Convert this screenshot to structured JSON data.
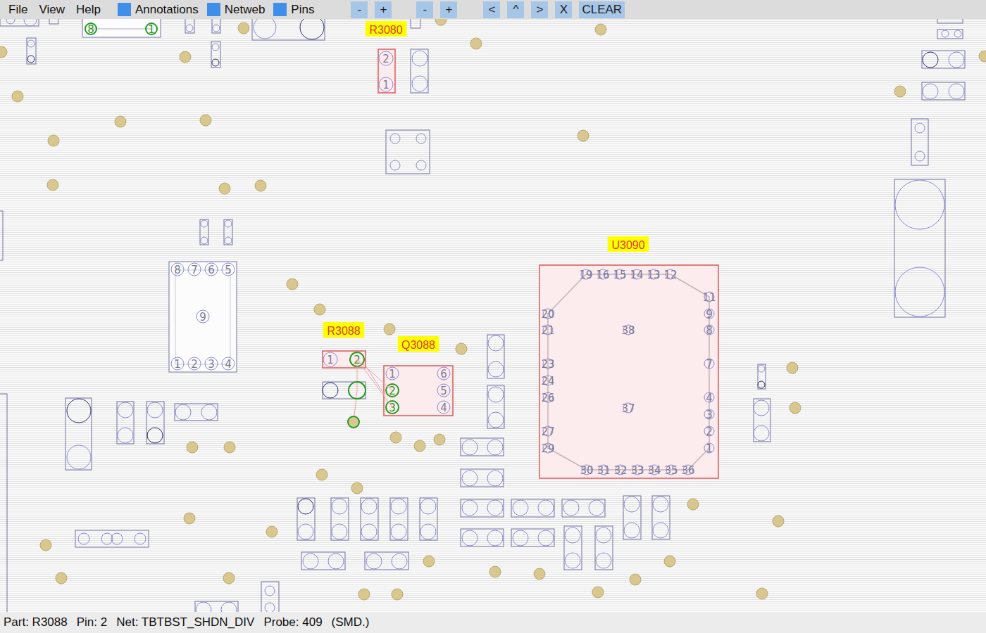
{
  "window": {
    "title": "OpenBoardView"
  },
  "menu": [
    "File",
    "View",
    "Help"
  ],
  "toggles": [
    {
      "label": "Annotations",
      "checked": true
    },
    {
      "label": "Netweb",
      "checked": true
    },
    {
      "label": "Pins",
      "checked": true
    }
  ],
  "button_groups": [
    [
      "-",
      "+"
    ],
    [
      "-",
      "+"
    ],
    [
      "<",
      "^",
      ">",
      "X",
      "CLEAR"
    ]
  ],
  "parts": [
    {
      "name": "R3080",
      "highlighted": true,
      "pins": [
        {
          "label": "2",
          "selected": false
        },
        {
          "label": "1",
          "selected": false
        }
      ]
    },
    {
      "name": "R3088",
      "highlighted": true,
      "pins": [
        {
          "label": "1",
          "selected": false
        },
        {
          "label": "2",
          "selected": true
        }
      ]
    },
    {
      "name": "Q3088",
      "highlighted": true,
      "pins": [
        {
          "label": "1",
          "selected": false
        },
        {
          "label": "2",
          "selected": true
        },
        {
          "label": "3",
          "selected": true
        },
        {
          "label": "4",
          "selected": false
        },
        {
          "label": "5",
          "selected": false
        },
        {
          "label": "6",
          "selected": false
        }
      ]
    },
    {
      "name": "U3090",
      "highlighted": true,
      "pins": [
        {
          "label": "1",
          "selected": false
        },
        {
          "label": "2",
          "selected": false
        },
        {
          "label": "3",
          "selected": false
        },
        {
          "label": "4",
          "selected": false
        },
        {
          "label": "7",
          "selected": false
        },
        {
          "label": "8",
          "selected": false
        },
        {
          "label": "9",
          "selected": false
        },
        {
          "label": "11",
          "selected": false
        },
        {
          "label": "12",
          "selected": false
        },
        {
          "label": "13",
          "selected": false
        },
        {
          "label": "14",
          "selected": false
        },
        {
          "label": "15",
          "selected": false
        },
        {
          "label": "16",
          "selected": false
        },
        {
          "label": "19",
          "selected": false
        },
        {
          "label": "20",
          "selected": false
        },
        {
          "label": "21",
          "selected": false
        },
        {
          "label": "23",
          "selected": false
        },
        {
          "label": "24",
          "selected": false
        },
        {
          "label": "26",
          "selected": false
        },
        {
          "label": "27",
          "selected": false
        },
        {
          "label": "29",
          "selected": false
        },
        {
          "label": "30",
          "selected": false
        },
        {
          "label": "31",
          "selected": false
        },
        {
          "label": "32",
          "selected": false
        },
        {
          "label": "33",
          "selected": false
        },
        {
          "label": "34",
          "selected": false
        },
        {
          "label": "35",
          "selected": false
        },
        {
          "label": "36",
          "selected": false
        },
        {
          "label": "37",
          "selected": false
        },
        {
          "label": "38",
          "selected": false
        }
      ]
    }
  ],
  "unlabeled_parts": [
    {
      "pins": [
        {
          "label": "8",
          "selected": true
        },
        {
          "label": "1",
          "selected": true
        }
      ]
    },
    {
      "pins": [
        {
          "label": "8",
          "selected": false
        },
        {
          "label": "7",
          "selected": false
        },
        {
          "label": "6",
          "selected": false
        },
        {
          "label": "5",
          "selected": false
        },
        {
          "label": "9",
          "selected": false
        },
        {
          "label": "1",
          "selected": false
        },
        {
          "label": "2",
          "selected": false
        },
        {
          "label": "3",
          "selected": false
        },
        {
          "label": "4",
          "selected": false
        }
      ]
    }
  ],
  "status_bar": [
    "Part: R3088",
    "Pin: 2",
    "Net: TBTBST_SHDN_DIV",
    "Probe: 409",
    "(SMD.)"
  ]
}
